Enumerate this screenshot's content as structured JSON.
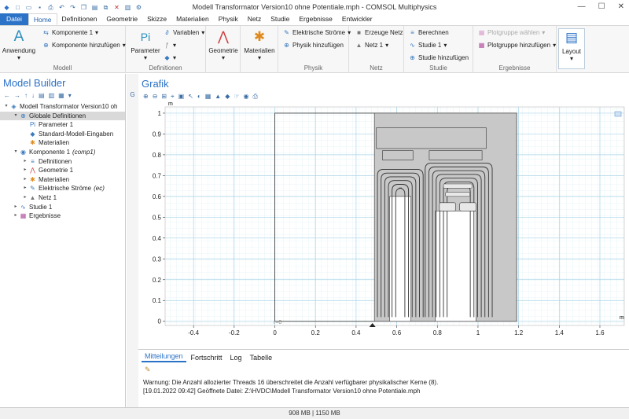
{
  "window": {
    "title": "Modell Transformator Version10 ohne Potentiale.mph - COMSOL Multiphysics",
    "controls": [
      "—",
      "☐",
      "✕"
    ]
  },
  "menu": {
    "tabs": [
      "Datei",
      "Home",
      "Definitionen",
      "Geometrie",
      "Skizze",
      "Materialien",
      "Physik",
      "Netz",
      "Studie",
      "Ergebnisse",
      "Entwickler"
    ]
  },
  "ribbon": {
    "modell": {
      "label": "Modell",
      "anwendung": "Anwendung",
      "komponente": "Komponente 1",
      "komponente_add": "Komponente hinzufügen"
    },
    "definitionen": {
      "label": "Definitionen",
      "parameter": "Parameter",
      "variablen": "Variablen",
      "pi": "Pi",
      "a_uppercase": "A"
    },
    "geometrie": {
      "label": "Geometrie"
    },
    "materialien": {
      "label": "Materialien"
    },
    "physik": {
      "label": "Physik",
      "elektrische": "Elektrische Ströme",
      "add": "Physik hinzufügen"
    },
    "netz": {
      "label": "Netz",
      "erzeuge": "Erzeuge Netz",
      "netz1": "Netz 1"
    },
    "studie": {
      "label": "Studie",
      "berechnen": "Berechnen",
      "studie1": "Studie 1",
      "add": "Studie hinzufügen"
    },
    "ergebnisse": {
      "label": "Ergebnisse",
      "plotgruppe_select": "Plotgruppe wählen",
      "plotgruppe_add": "Plotgruppe hinzufügen"
    },
    "layout": {
      "label": "Layout"
    }
  },
  "model_builder": {
    "title": "Model Builder",
    "tree": [
      {
        "label": "Modell Transformator Version10 oh",
        "indent": 0,
        "icon": "◈",
        "color": "#3a7bbf",
        "toggle": "▾",
        "selected": false
      },
      {
        "label": "Globale Definitionen",
        "indent": 1,
        "icon": "⊕",
        "color": "#3a7bbf",
        "toggle": "▾",
        "selected": true
      },
      {
        "label": "Parameter 1",
        "indent": 2,
        "icon": "Pi",
        "color": "#3a7bbf",
        "toggle": "",
        "selected": false
      },
      {
        "label": "Standard-Modell-Eingaben",
        "indent": 2,
        "icon": "◆",
        "color": "#3a7bbf",
        "toggle": "",
        "selected": false
      },
      {
        "label": "Materialien",
        "indent": 2,
        "icon": "✱",
        "color": "#e08a1e",
        "toggle": "",
        "selected": false
      },
      {
        "label": "Komponente 1",
        "suffix": "(comp1)",
        "indent": 1,
        "icon": "◉",
        "color": "#3a7bbf",
        "toggle": "▾",
        "selected": false
      },
      {
        "label": "Definitionen",
        "indent": 2,
        "icon": "≡",
        "color": "#3a7bbf",
        "toggle": "▸",
        "selected": false
      },
      {
        "label": "Geometrie 1",
        "indent": 2,
        "icon": "⋀",
        "color": "#d04040",
        "toggle": "▸",
        "selected": false
      },
      {
        "label": "Materialien",
        "indent": 2,
        "icon": "✱",
        "color": "#e08a1e",
        "toggle": "▸",
        "selected": false
      },
      {
        "label": "Elektrische Ströme",
        "suffix": "(ec)",
        "indent": 2,
        "icon": "✎",
        "color": "#3a7bbf",
        "toggle": "▸",
        "selected": false
      },
      {
        "label": "Netz 1",
        "indent": 2,
        "icon": "▲",
        "color": "#777777",
        "toggle": "▸",
        "selected": false
      },
      {
        "label": "Studie 1",
        "indent": 1,
        "icon": "∿",
        "color": "#3a7bbf",
        "toggle": "▸",
        "selected": false
      },
      {
        "label": "Ergebnisse",
        "indent": 1,
        "icon": "▦",
        "color": "#b04a9a",
        "toggle": "▸",
        "selected": false
      }
    ]
  },
  "graphics": {
    "title": "Grafik",
    "unit_top": "m",
    "unit_right": "m",
    "ticks_x": [
      "-0.4",
      "-0.2",
      "0",
      "0.2",
      "0.4",
      "0.6",
      "0.8",
      "1",
      "1.2",
      "1.4",
      "1.6"
    ],
    "ticks_y": [
      "1",
      "0.9",
      "0.8",
      "0.7",
      "0.6",
      "0.5",
      "0.4",
      "0.3",
      "0.2",
      "0.1",
      "0"
    ],
    "r_label": "r=0",
    "x_range": [
      -0.54,
      1.72
    ],
    "y_range": [
      -0.02,
      1.03
    ]
  },
  "messages": {
    "tabs": [
      "Mitteilungen",
      "Fortschritt",
      "Log",
      "Tabelle"
    ],
    "lines": [
      "Warnung: Die Anzahl allozierter Threads 16 überschreitet die Anzahl verfügbarer physikalischer Kerne (8).",
      "[19.01.2022 09:42] Geöffnete Datei: Z:\\HVDC\\Modell Transformator Version10 ohne Potentiale.mph"
    ]
  },
  "status": {
    "memory": "908 MB | 1150 MB"
  },
  "colors": {
    "accent": "#2c72c7",
    "grid": "#bfe0ec",
    "geom_fill": "#c8c8c8"
  }
}
